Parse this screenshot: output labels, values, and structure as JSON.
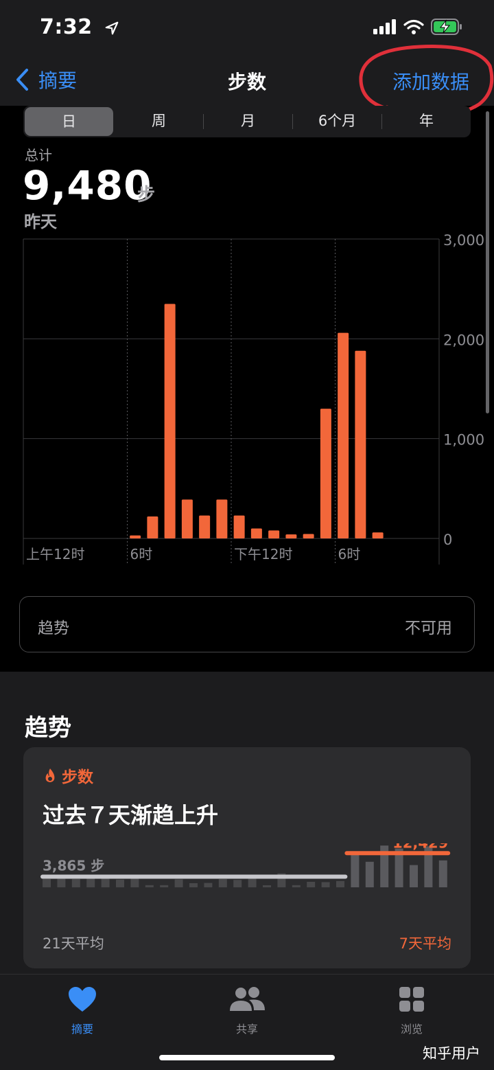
{
  "status": {
    "time": "7:32"
  },
  "nav": {
    "back_label": "摘要",
    "title": "步数",
    "action_label": "添加数据"
  },
  "segments": [
    "日",
    "周",
    "月",
    "6个月",
    "年"
  ],
  "summary": {
    "total_label": "总计",
    "total_value": "9,480",
    "unit": "步",
    "date_label": "昨天"
  },
  "chart_data": {
    "type": "bar",
    "x": [
      0,
      1,
      2,
      3,
      4,
      5,
      6,
      7,
      8,
      9,
      10,
      11,
      12,
      13,
      14,
      15,
      16,
      17,
      18,
      19,
      20,
      21,
      22,
      23
    ],
    "values": [
      0,
      0,
      0,
      0,
      0,
      0,
      30,
      220,
      2350,
      390,
      230,
      390,
      230,
      100,
      80,
      40,
      45,
      1300,
      2060,
      1880,
      60,
      0,
      0,
      0
    ],
    "ylim": [
      0,
      3000
    ],
    "yticks": [
      "3,000",
      "2,000",
      "1,000",
      "0"
    ],
    "xticks": [
      "上午12时",
      "6时",
      "下午12时",
      "6时"
    ],
    "color": "#f2673a"
  },
  "trend_row": {
    "label": "趋势",
    "value": "不可用"
  },
  "trends": {
    "section_title": "趋势",
    "card": {
      "category": "步数",
      "headline": "过去７天渐趋上升",
      "avg21_value": "3,865 步",
      "avg7_value": "12,429",
      "avg21_label": "21天平均",
      "avg7_label": "7天平均",
      "bars21": [
        3000,
        3100,
        3000,
        3200,
        3600,
        2800,
        4300,
        800,
        800,
        2900,
        1500,
        1600,
        3000,
        2700,
        3900,
        400,
        5100,
        800,
        2000,
        1900,
        2300
      ],
      "bars7": [
        12900,
        9300,
        15200,
        14100,
        8100,
        14900,
        9800
      ],
      "avg21": 3865,
      "avg7": 12429,
      "max": 16000,
      "accent": "#f2673a"
    }
  },
  "tabbar": {
    "summary": "摘要",
    "sharing": "共享",
    "browse": "浏览"
  },
  "watermark": "知乎用户"
}
